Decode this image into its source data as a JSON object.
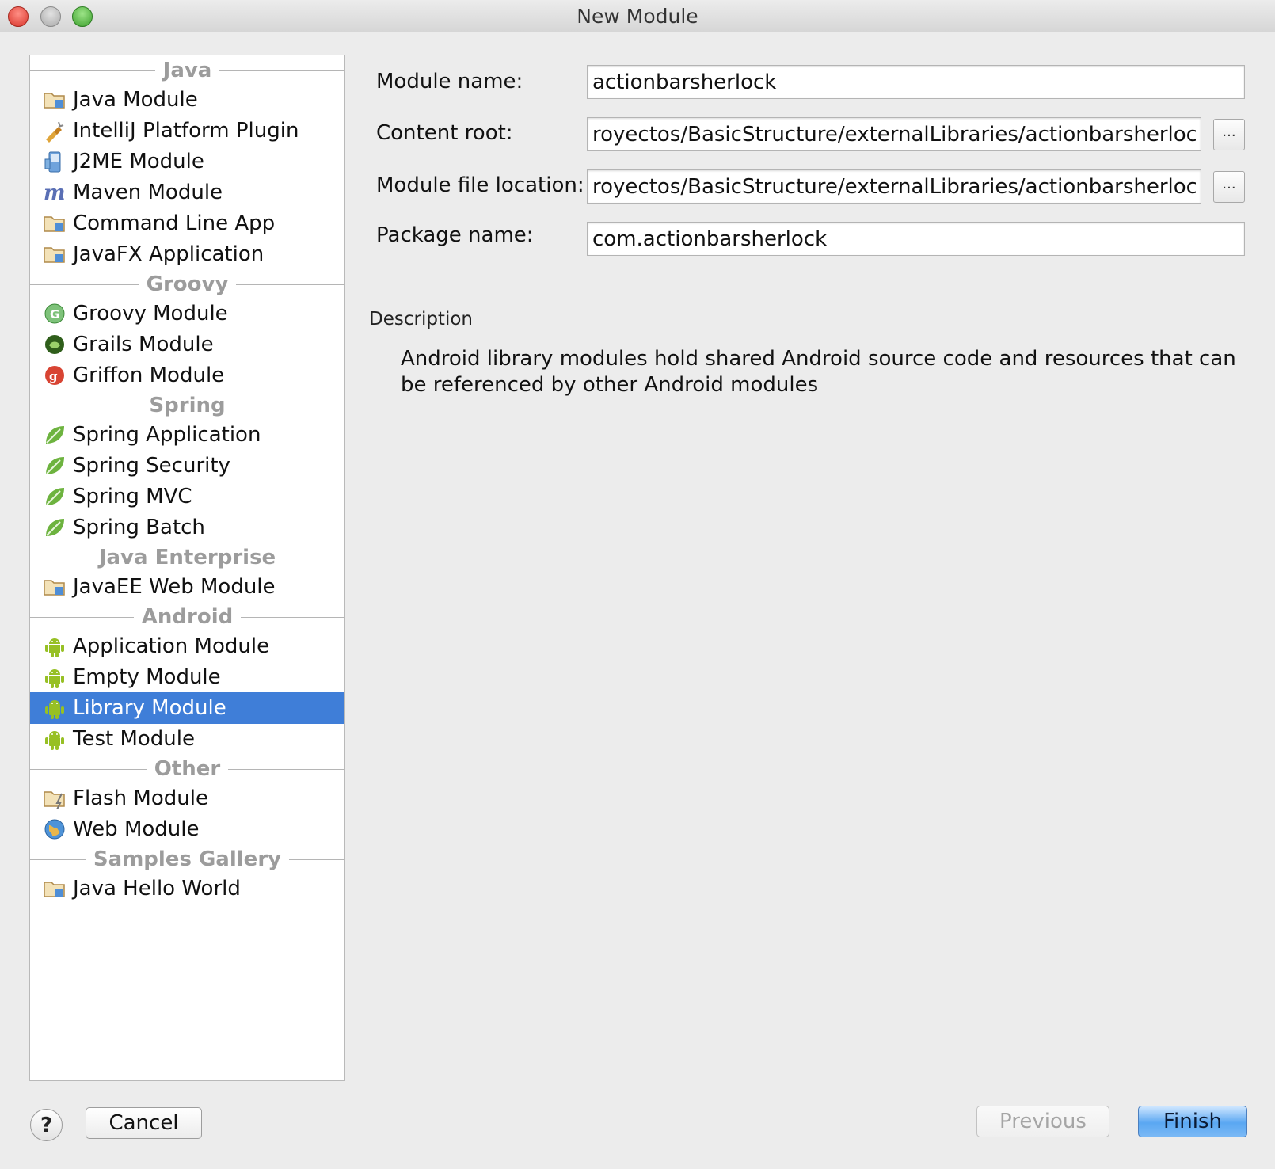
{
  "window": {
    "title": "New Module"
  },
  "module_list": {
    "groups": [
      {
        "title": "Java",
        "items": [
          {
            "label": "Java Module",
            "icon": "folder-module-icon"
          },
          {
            "label": "IntelliJ Platform Plugin",
            "icon": "plugin-icon"
          },
          {
            "label": "J2ME Module",
            "icon": "j2me-phone-icon"
          },
          {
            "label": "Maven Module",
            "icon": "maven-icon"
          },
          {
            "label": "Command Line App",
            "icon": "folder-module-icon"
          },
          {
            "label": "JavaFX Application",
            "icon": "folder-module-icon"
          }
        ]
      },
      {
        "title": "Groovy",
        "items": [
          {
            "label": "Groovy Module",
            "icon": "groovy-icon"
          },
          {
            "label": "Grails Module",
            "icon": "grails-icon"
          },
          {
            "label": "Griffon Module",
            "icon": "griffon-icon"
          }
        ]
      },
      {
        "title": "Spring",
        "items": [
          {
            "label": "Spring Application",
            "icon": "spring-leaf-icon"
          },
          {
            "label": "Spring Security",
            "icon": "spring-leaf-icon"
          },
          {
            "label": "Spring MVC",
            "icon": "spring-leaf-icon"
          },
          {
            "label": "Spring Batch",
            "icon": "spring-leaf-icon"
          }
        ]
      },
      {
        "title": "Java Enterprise",
        "items": [
          {
            "label": "JavaEE Web Module",
            "icon": "folder-module-icon"
          }
        ]
      },
      {
        "title": "Android",
        "items": [
          {
            "label": "Application Module",
            "icon": "android-icon"
          },
          {
            "label": "Empty Module",
            "icon": "android-icon"
          },
          {
            "label": "Library Module",
            "icon": "android-icon",
            "selected": true
          },
          {
            "label": "Test Module",
            "icon": "android-icon"
          }
        ]
      },
      {
        "title": "Other",
        "items": [
          {
            "label": "Flash Module",
            "icon": "flash-icon"
          },
          {
            "label": "Web Module",
            "icon": "globe-icon"
          }
        ]
      },
      {
        "title": "Samples Gallery",
        "items": [
          {
            "label": "Java Hello World",
            "icon": "folder-module-icon"
          }
        ]
      }
    ]
  },
  "form": {
    "module_name_label": "Module name:",
    "module_name_value": "actionbarsherlock",
    "content_root_label": "Content root:",
    "content_root_value": "royectos/BasicStructure/externalLibraries/actionbarsherlock",
    "module_file_label": "Module file location:",
    "module_file_value": "royectos/BasicStructure/externalLibraries/actionbarsherlock",
    "package_name_label": "Package name:",
    "package_name_value": "com.actionbarsherlock",
    "browse_label": "..."
  },
  "description": {
    "title": "Description",
    "text": "Android library modules hold shared Android source code and resources that can be referenced by other Android modules"
  },
  "buttons": {
    "help": "?",
    "cancel": "Cancel",
    "previous": "Previous",
    "finish": "Finish"
  },
  "colors": {
    "selection": "#3f7ed8",
    "android_green": "#97c024",
    "spring_green": "#6db33f"
  }
}
